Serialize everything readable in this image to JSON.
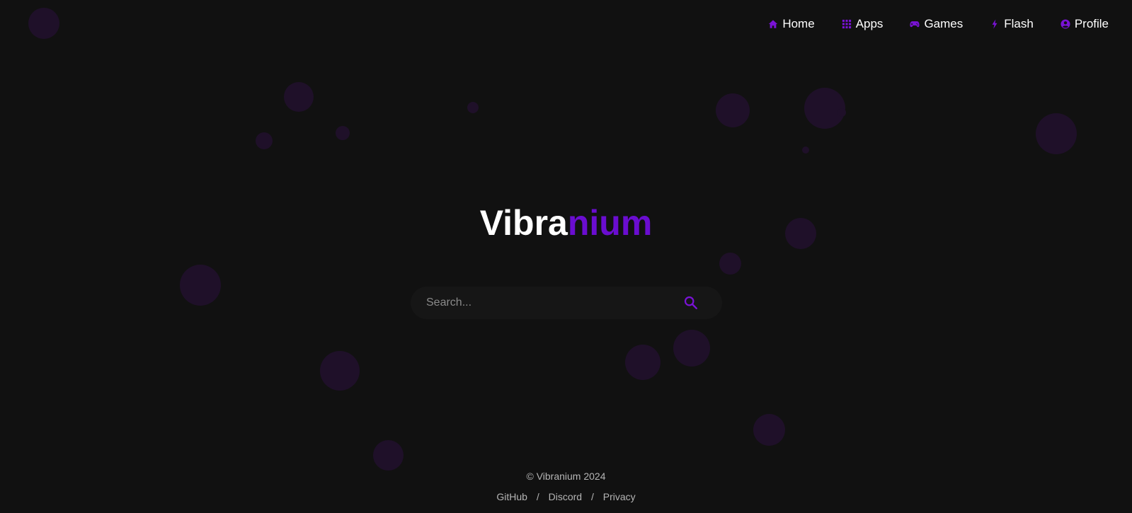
{
  "colors": {
    "background": "#111111",
    "accent": "#6a0dd0",
    "icon_accent": "#7a12d6",
    "bubble": "#1f1029",
    "text": "#ffffff",
    "muted": "#b5b5b5"
  },
  "nav": {
    "items": [
      {
        "label": "Home",
        "icon": "home-icon"
      },
      {
        "label": "Apps",
        "icon": "apps-grid-icon"
      },
      {
        "label": "Games",
        "icon": "gamepad-icon"
      },
      {
        "label": "Flash",
        "icon": "bolt-icon"
      },
      {
        "label": "Profile",
        "icon": "user-circle-icon"
      }
    ]
  },
  "brand": {
    "part1": "Vibra",
    "part2": "nium"
  },
  "search": {
    "placeholder": "Search...",
    "value": "",
    "icon": "search-icon"
  },
  "footer": {
    "copyright": "© Vibranium 2024",
    "links": [
      "GitHub",
      "Discord",
      "Privacy"
    ],
    "separator": "/"
  }
}
